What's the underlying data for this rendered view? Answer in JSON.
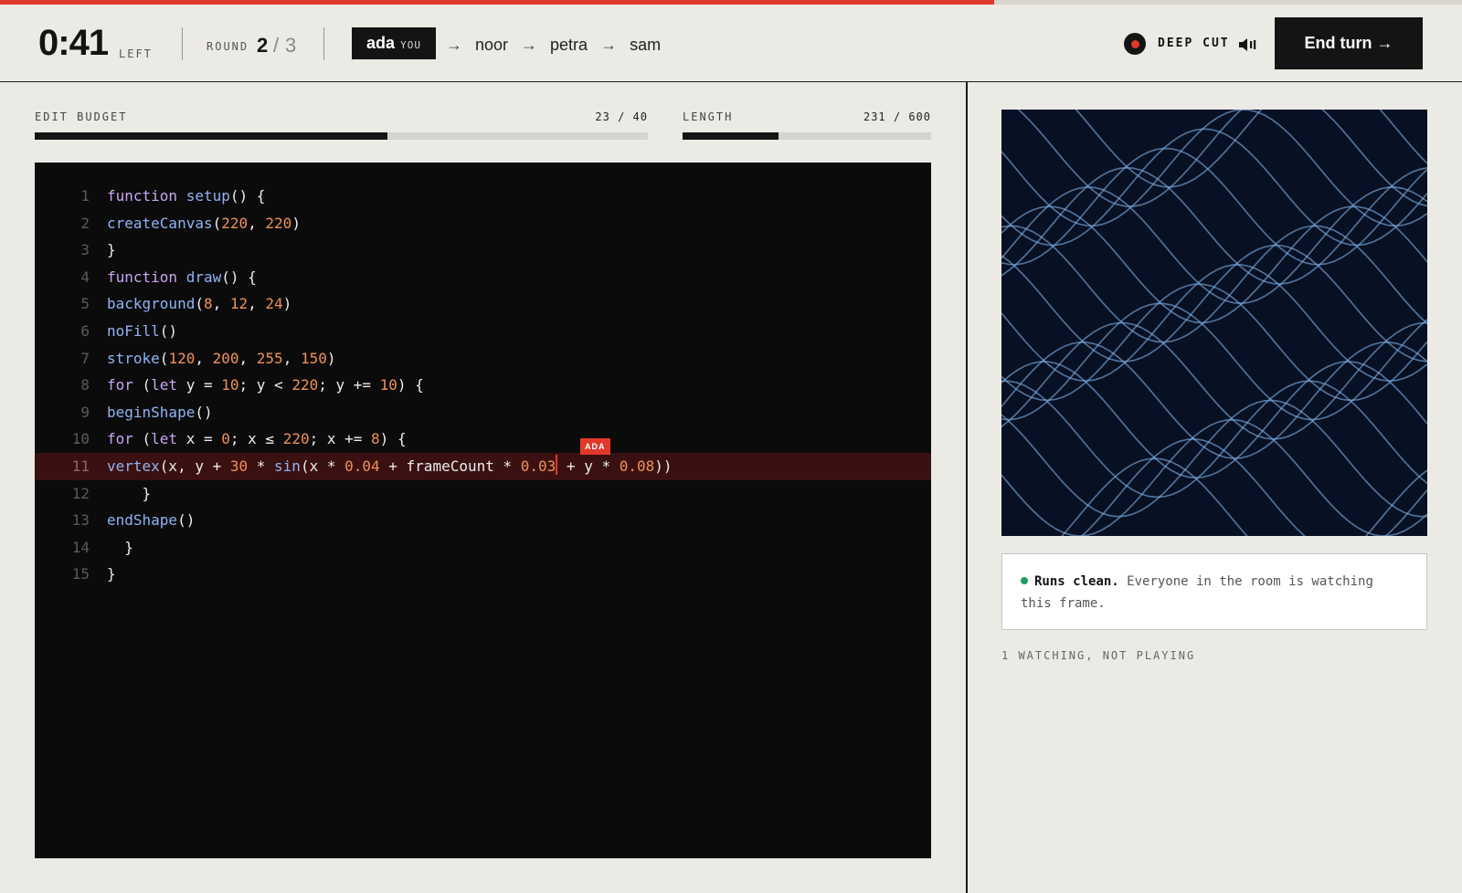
{
  "turn_progress": 0.68,
  "colors": {
    "accent": "#E0392B",
    "ink": "#141414",
    "paper": "#ECEAE5",
    "editor_bg": "#0B0B0B",
    "status_ok": "#1E9E63",
    "wave": "#7FB3E6"
  },
  "header": {
    "timer": "0:41",
    "timer_suffix": "LEFT",
    "round_label": "ROUND",
    "round_current": "2",
    "round_separator": "/",
    "round_total": "3",
    "current_player": {
      "name": "ada",
      "tag": "YOU"
    },
    "players_next": [
      "noor",
      "petra",
      "sam"
    ],
    "arrow_glyph": "→",
    "mode_label": "DEEP CUT",
    "mode_icon": "record-icon",
    "sound_icon": "speaker-icon",
    "end_turn_label": "End turn →"
  },
  "meters": {
    "edit_budget": {
      "label": "EDIT BUDGET",
      "value": "23 / 40",
      "used": 23,
      "max": 40
    },
    "length": {
      "label": "LENGTH",
      "value": "231 / 600",
      "used": 231,
      "max": 600
    }
  },
  "editor": {
    "active_line": 11,
    "cursor_tag": "ADA",
    "lines": [
      {
        "n": "1",
        "code": "function setup() {"
      },
      {
        "n": "2",
        "code": "createCanvas(220, 220)"
      },
      {
        "n": "3",
        "code": "}"
      },
      {
        "n": "4",
        "code": "function draw() {"
      },
      {
        "n": "5",
        "code": "background(8, 12, 24)"
      },
      {
        "n": "6",
        "code": "noFill()"
      },
      {
        "n": "7",
        "code": "stroke(120, 200, 255, 150)"
      },
      {
        "n": "8",
        "code": "for (let y = 10; y < 220; y += 10) {"
      },
      {
        "n": "9",
        "code": "beginShape()"
      },
      {
        "n": "10",
        "code": "for (let x = 0; x ≤ 220; x += 8) {"
      },
      {
        "n": "11",
        "code": "vertex(x, y + 30 * sin(x * 0.04 + frameCount * 0.03 + y * 0.08))"
      },
      {
        "n": "12",
        "code": "    }"
      },
      {
        "n": "13",
        "code": "endShape()"
      },
      {
        "n": "14",
        "code": "  }"
      },
      {
        "n": "15",
        "code": "}"
      }
    ]
  },
  "status": {
    "strong": "Runs clean.",
    "text": " Everyone in the room is watching this frame."
  },
  "watching_text": "1 WATCHING, NOT PLAYING"
}
